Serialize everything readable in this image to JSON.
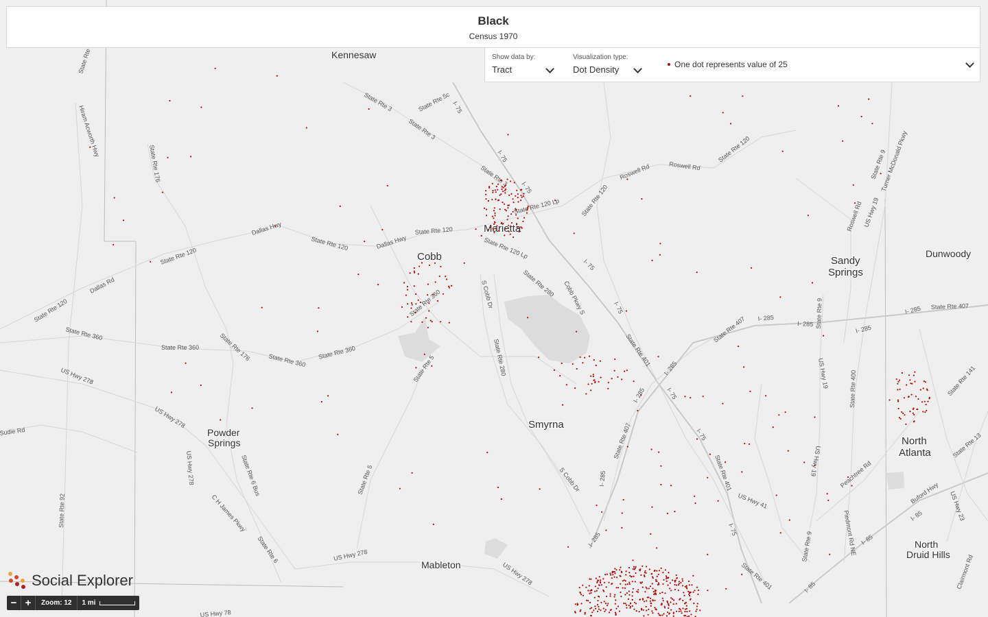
{
  "header": {
    "title": "Black",
    "subtitle": "Census 1970"
  },
  "controls": {
    "show_data_label": "Show data by:",
    "show_data_value": "Tract",
    "viz_type_label": "Visualization type:",
    "viz_type_value": "Dot Density",
    "legend_text": "One dot represents value of 25"
  },
  "colors": {
    "dot": "#b00c0c",
    "map_background": "#efefef",
    "road": "#c9c9c9"
  },
  "map": {
    "county": "Cobb",
    "cities": [
      "Kennesaw",
      "Marietta",
      "Smyrna",
      "Powder Springs",
      "Mableton",
      "Sandy Springs",
      "Dunwoody",
      "North Atlanta",
      "North Druid Hills"
    ],
    "road_labels": [
      "State Rte 3",
      "State Rte 5c",
      "I- 75",
      "State Rte 176",
      "Hiram Acworth Hwy",
      "Dallas Hwy",
      "State Rte 120",
      "Dallas Rd",
      "State Rte 360",
      "US Hwy 278",
      "Roswell Rd",
      "State Rte 120 Lp",
      "Cobb Pkwy S",
      "State Rte 280",
      "S Cobb Dr",
      "State Rte 401",
      "I- 285",
      "State Rte 407",
      "US Hwy 19",
      "State Rte 400",
      "State Rte 9",
      "State Rte 141",
      "Peachtree Rd",
      "Buford Hwy",
      "I- 85",
      "US Hwy 41",
      "C H James Pkwy",
      "State Rte 6",
      "State Rte 6 Bus",
      "State Rte 92",
      "State Rte 5",
      "Turner McDonald Pkwy",
      "Piedmont Rd NE",
      "US Hwy 23",
      "State Rte 13",
      "Clairmont Rd",
      "US Hwy 78",
      "Sudie Rd"
    ]
  },
  "zoom": {
    "minus": "−",
    "plus": "+",
    "level_label": "Zoom: 12",
    "scale_label": "1 mi"
  },
  "brand": {
    "name": "Social Explorer",
    "colors": [
      "#e8a33a",
      "#d9462b",
      "#b01f24"
    ]
  }
}
